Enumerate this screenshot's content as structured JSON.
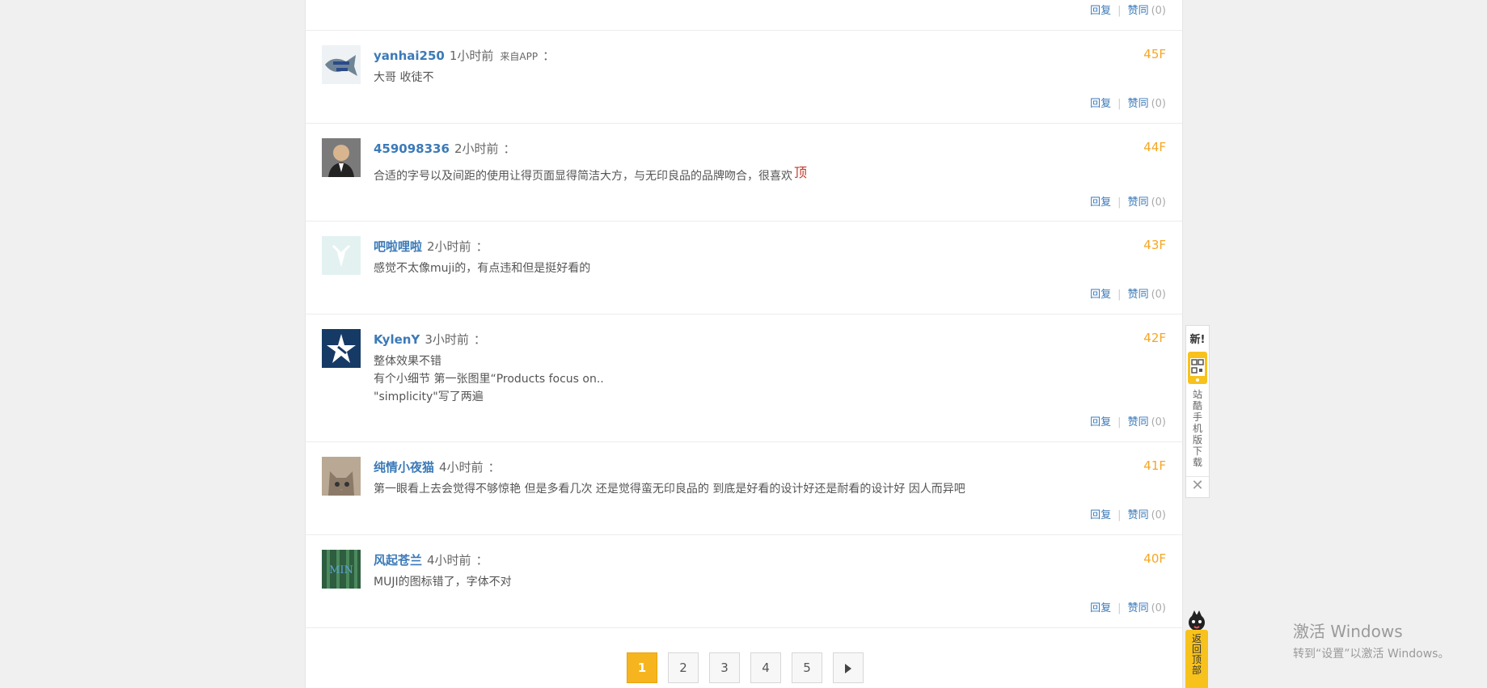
{
  "top_actions": {
    "reply": "回复",
    "like": "赞同",
    "count": "(0)"
  },
  "comments": [
    {
      "author": "yanhai250",
      "time": "1小时前",
      "via": "来自APP",
      "colon": "：",
      "text": "大哥 收徒不",
      "floor": "45F",
      "reply": "回复",
      "like": "赞同",
      "count": "(0)",
      "avatar": "fish-logo"
    },
    {
      "author": "459098336",
      "time": "2小时前",
      "colon": "：",
      "text": "合适的字号以及间距的使用让得页面显得简洁大方，与无印良品的品牌吻合，很喜欢",
      "badge": "顶",
      "floor": "44F",
      "reply": "回复",
      "like": "赞同",
      "count": "(0)",
      "avatar": "man-photo"
    },
    {
      "author": "吧啦哩啦",
      "time": "2小时前",
      "colon": "：",
      "text": "感觉不太像muji的，有点违和但是挺好看的",
      "floor": "43F",
      "reply": "回复",
      "like": "赞同",
      "count": "(0)",
      "avatar": "tie-icon"
    },
    {
      "author": "KylenY",
      "time": "3小时前",
      "colon": "：",
      "text_lines": [
        "整体效果不错",
        "有个小细节 第一张图里“Products focus on..",
        "\"simplicity\"写了两遍"
      ],
      "floor": "42F",
      "reply": "回复",
      "like": "赞同",
      "count": "(0)",
      "avatar": "star-logo"
    },
    {
      "author": "纯情小夜猫",
      "time": "4小时前",
      "colon": "：",
      "text": "第一眼看上去会觉得不够惊艳 但是多看几次 还是觉得蛮无印良品的 到底是好看的设计好还是耐看的设计好 因人而异吧",
      "floor": "41F",
      "reply": "回复",
      "like": "赞同",
      "count": "(0)",
      "avatar": "cat-photo"
    },
    {
      "author": "风起苍兰",
      "time": "4小时前",
      "colon": "：",
      "text": "MUJI的图标错了，字体不对",
      "floor": "40F",
      "reply": "回复",
      "like": "赞同",
      "count": "(0)",
      "avatar": "bamboo-photo",
      "avatar_text": "MIN"
    }
  ],
  "pagination": {
    "pages": [
      "1",
      "2",
      "3",
      "4",
      "5"
    ],
    "current": "1"
  },
  "side_widget": {
    "new": "新!",
    "label_chars": [
      "站",
      "酷",
      "手",
      "机",
      "版",
      "下",
      "载"
    ],
    "close": "✕"
  },
  "back_to_top": {
    "label_chars": [
      "返",
      "回",
      "顶",
      "部"
    ]
  },
  "windows_activation": {
    "line1": "激活 Windows",
    "line2": "转到“设置”以激活 Windows。"
  },
  "colors": {
    "accent": "#f6b51e",
    "link": "#3b7ab8",
    "floor": "#f5a623"
  }
}
